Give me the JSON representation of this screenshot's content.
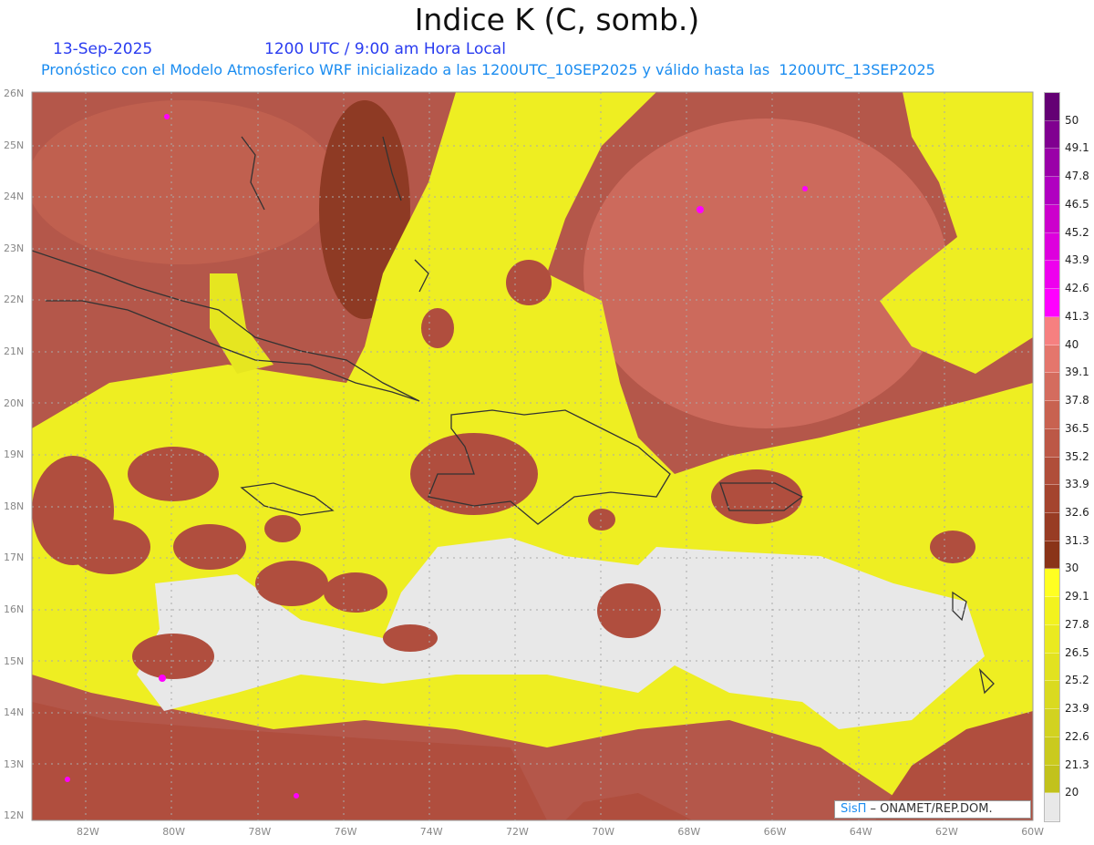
{
  "header": {
    "title": "Indice K (C, somb.)",
    "date": "13-Sep-2025",
    "time": "1200 UTC / 9:00 am Hora Local",
    "description": "Pronóstico con el Modelo Atmosferico WRF inicializado a las 1200UTC_10SEP2025 y válido hasta las  1200UTC_13SEP2025"
  },
  "axes": {
    "lat_labels": [
      "26N",
      "25N",
      "24N",
      "23N",
      "22N",
      "21N",
      "20N",
      "19N",
      "18N",
      "17N",
      "16N",
      "15N",
      "14N",
      "13N",
      "12N"
    ],
    "lon_labels": [
      "82W",
      "80W",
      "78W",
      "76W",
      "74W",
      "72W",
      "70W",
      "68W",
      "66W",
      "64W",
      "62W",
      "60W"
    ]
  },
  "colorbar": {
    "labels": [
      "20",
      "21.3",
      "22.6",
      "23.9",
      "25.2",
      "26.5",
      "27.8",
      "29.1",
      "30",
      "31.3",
      "32.6",
      "33.9",
      "35.2",
      "36.5",
      "37.8",
      "39.1",
      "40",
      "41.3",
      "42.6",
      "43.9",
      "45.2",
      "46.5",
      "47.8",
      "49.1",
      "50"
    ],
    "colors": [
      "#e8e8e8",
      "#c2c21c",
      "#caca1e",
      "#d2d220",
      "#dada20",
      "#e2e220",
      "#eaea20",
      "#f2f21e",
      "#ffff22",
      "#8a3418",
      "#983c24",
      "#a4442e",
      "#b04e3a",
      "#bc5846",
      "#c86250",
      "#d46c5e",
      "#e4766c",
      "#f68080",
      "#ff00ff",
      "#ee00ee",
      "#dd00dd",
      "#cc00cc",
      "#b000c0",
      "#9a00a8",
      "#800090",
      "#640074"
    ]
  },
  "credit": {
    "brand": "SisΠ",
    "text": " –  ONAMET/REP.DOM."
  }
}
